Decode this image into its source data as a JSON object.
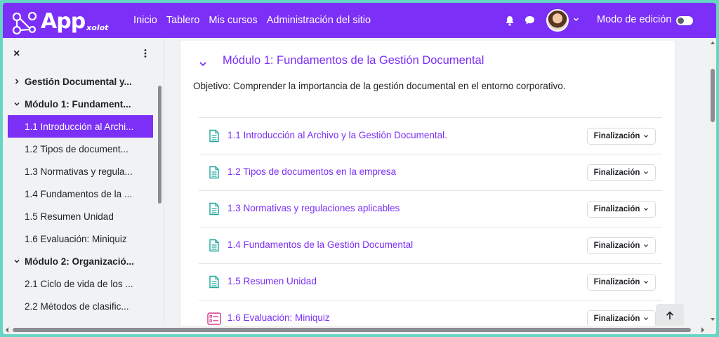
{
  "brand": {
    "app": "App",
    "sub": "xolot"
  },
  "nav": {
    "links": [
      "Inicio",
      "Tablero",
      "Mis cursos",
      "Administración del sitio"
    ],
    "edit_mode": "Modo de edición"
  },
  "sidebar": {
    "close": "×",
    "items": [
      {
        "label": "Gestión Documental y...",
        "kind": "section",
        "expanded": false
      },
      {
        "label": "Módulo 1: Fundament...",
        "kind": "section",
        "expanded": true
      },
      {
        "label": "1.1 Introducción al Archi...",
        "kind": "sub",
        "active": true
      },
      {
        "label": "1.2 Tipos de document...",
        "kind": "sub"
      },
      {
        "label": "1.3 Normativas y regula...",
        "kind": "sub"
      },
      {
        "label": "1.4 Fundamentos de la ...",
        "kind": "sub"
      },
      {
        "label": "1.5 Resumen Unidad",
        "kind": "sub"
      },
      {
        "label": "1.6 Evaluación: Miniquiz",
        "kind": "sub"
      },
      {
        "label": "Módulo 2: Organizació...",
        "kind": "section",
        "expanded": true
      },
      {
        "label": "2.1 Ciclo de vida de los ...",
        "kind": "sub"
      },
      {
        "label": "2.2 Métodos de clasific...",
        "kind": "sub"
      }
    ]
  },
  "main": {
    "module_title": "Módulo 1: Fundamentos de la Gestión Documental",
    "objective": "Objetivo: Comprender la importancia de la gestión documental en el entorno corporativo.",
    "activities": [
      {
        "name": "1.1 Introducción al Archivo y la Gestión Documental.",
        "icon": "page-icon",
        "status": "Finalización"
      },
      {
        "name": "1.2 Tipos de documentos en la empresa",
        "icon": "page-icon",
        "status": "Finalización"
      },
      {
        "name": "1.3 Normativas y regulaciones aplicables",
        "icon": "page-icon",
        "status": "Finalización"
      },
      {
        "name": "1.4 Fundamentos de la Gestión Documental",
        "icon": "page-icon",
        "status": "Finalización"
      },
      {
        "name": "1.5 Resumen Unidad",
        "icon": "page-icon",
        "status": "Finalización"
      },
      {
        "name": "1.6 Evaluación: Miniquiz",
        "icon": "quiz-icon",
        "status": "Finalización"
      }
    ]
  },
  "colors": {
    "brand": "#7b2ff7",
    "accent_icon": "#1fa89b",
    "quiz_icon": "#d6338c",
    "frame": "#66d6c4"
  }
}
